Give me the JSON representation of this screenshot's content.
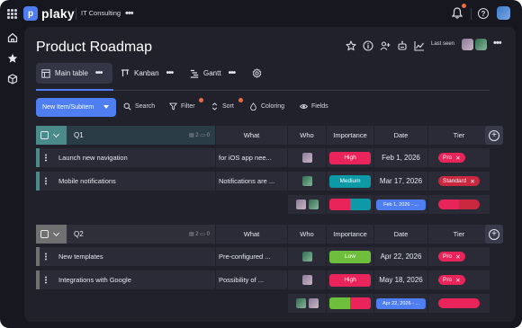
{
  "app": {
    "logo_text": "plaky",
    "workspace": "IT Consulting"
  },
  "board": {
    "title": "Product Roadmap",
    "last_seen_label": "Last seen"
  },
  "views": [
    {
      "label": "Main table",
      "icon": "table-icon",
      "active": true
    },
    {
      "label": "Kanban",
      "icon": "kanban-icon",
      "active": false
    },
    {
      "label": "Gantt",
      "icon": "gantt-icon",
      "active": false
    }
  ],
  "toolbar": {
    "new_item": "New Item/Subitem",
    "search": "Search",
    "filter": "Filter",
    "sort": "Sort",
    "coloring": "Coloring",
    "fields": "Fields"
  },
  "columns": {
    "what": "What",
    "who": "Who",
    "importance": "Importance",
    "date": "Date",
    "tier": "Tier"
  },
  "groups": [
    {
      "name": "Q1",
      "counts": {
        "files": "2",
        "comments": "0"
      },
      "color": "#4b8a8a",
      "rows": [
        {
          "name": "Launch new navigation",
          "what": "for iOS app nee...",
          "importance": "High",
          "importance_color": "#e8245a",
          "date": "Feb 1, 2026",
          "tier": "Pro"
        },
        {
          "name": "Mobile notifications",
          "what": "Notifications are ...",
          "importance": "Medium",
          "importance_color": "#0d9aa6",
          "date": "Mar 17, 2026",
          "tier": "Standard"
        }
      ],
      "summary": {
        "date_range": "Feb 1, 2026 - ...",
        "importance_split": [
          0.5,
          0.5
        ],
        "importance_colors": [
          "#e8245a",
          "#0d9aa6"
        ],
        "tier_split": [
          0.5,
          0.5
        ],
        "tier_colors": [
          "#e8245a",
          "#c9283f"
        ]
      }
    },
    {
      "name": "Q2",
      "counts": {
        "files": "2",
        "comments": "0"
      },
      "color": "#707070",
      "rows": [
        {
          "name": "New templates",
          "what": "Pre-configured ...",
          "importance": "Low",
          "importance_color": "#6fbf3c",
          "date": "Apr 22, 2026",
          "tier": "Pro"
        },
        {
          "name": "Integrations with Google",
          "what": "Possibility of ...",
          "importance": "High",
          "importance_color": "#e8245a",
          "date": "May 18, 2026",
          "tier": "Pro"
        }
      ],
      "summary": {
        "date_range": "Apr 22, 2026 - ...",
        "importance_split": [
          0.5,
          0.5
        ],
        "importance_colors": [
          "#6fbf3c",
          "#e8245a"
        ],
        "tier_split": [
          1.0
        ],
        "tier_colors": [
          "#e8245a"
        ]
      }
    }
  ],
  "colors": {
    "accent": "#4e7ef0",
    "background": "#17171f",
    "board": "#21212b",
    "cell": "#2a2b36",
    "notification_dot": "#f06a3c"
  }
}
